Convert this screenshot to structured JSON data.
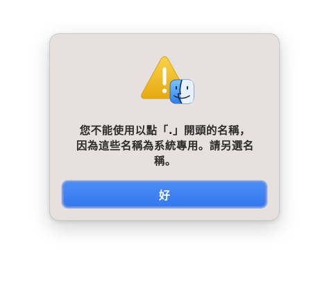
{
  "dialog": {
    "icon": "warning-icon",
    "badge_icon": "finder-icon",
    "message_lines": [
      "您不能使用以點「.」開頭的名稱，",
      "因為這些名稱為系統專用。請另選名",
      "稱。"
    ],
    "ok_label": "好"
  },
  "colors": {
    "dialog_bg": "#e6e1df",
    "button_blue": "#3478f0",
    "warning_yellow": "#f0c419",
    "finder_blue": "#3a86f0"
  }
}
